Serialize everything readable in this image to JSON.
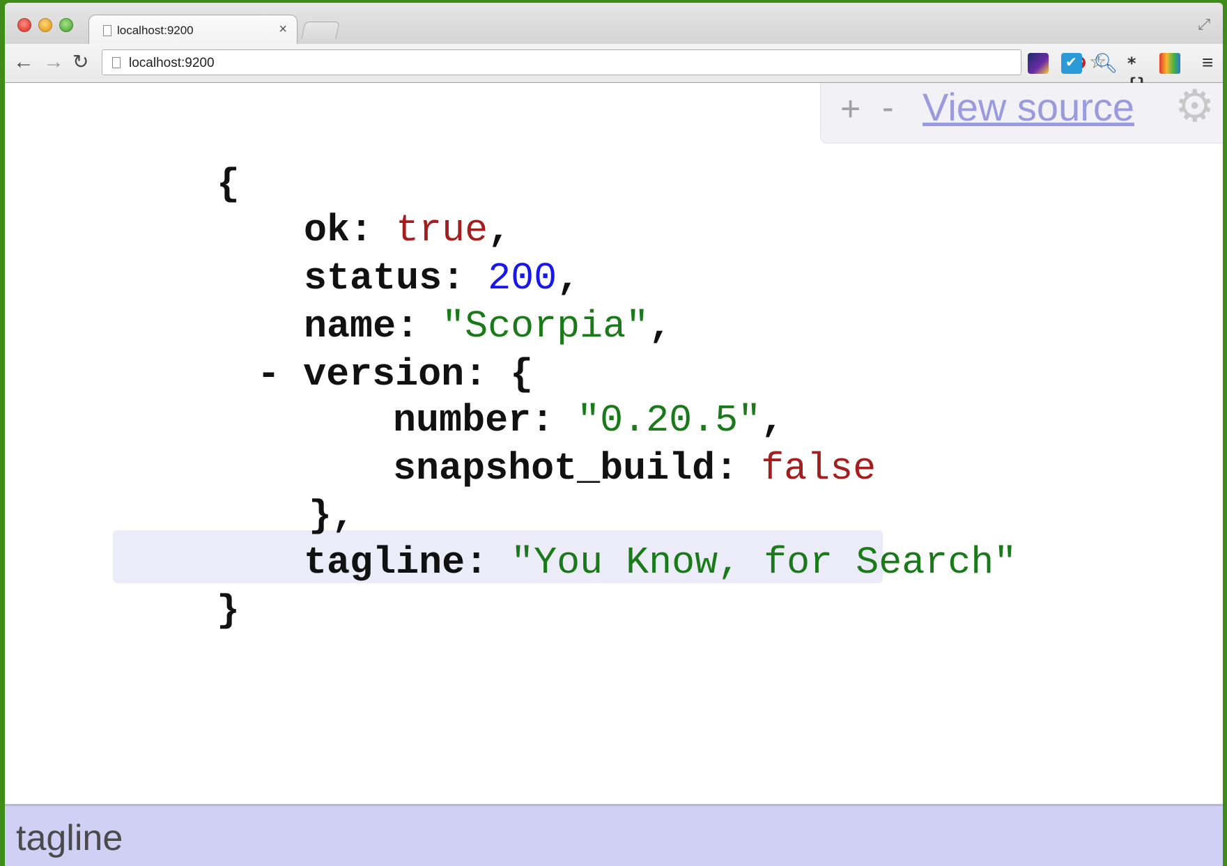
{
  "browser": {
    "tab": {
      "title": "localhost:9200",
      "close_glyph": "×"
    },
    "address_bar": {
      "url": "localhost:9200"
    },
    "nav": {
      "back": "←",
      "forward": "→",
      "reload": "↻"
    },
    "extensions": [
      "adblock-plus-icon",
      "bookmark-star-icon",
      "extension-icon",
      "checkmark-extension-icon",
      "search-extension-icon",
      "json-extension-icon",
      "color-extension-icon"
    ],
    "abp_label": "ABP",
    "json_ext_label": "*{}",
    "menu_glyph": "≡"
  },
  "viewer_toolbar": {
    "expand_label": "+",
    "collapse_label": "-",
    "view_source_label": "View source",
    "settings_glyph": "⚙"
  },
  "json": {
    "open_brace": "{",
    "ok": {
      "key": "ok:",
      "value": "true",
      "trail": ","
    },
    "status": {
      "key": "status:",
      "value": "200",
      "trail": ","
    },
    "name": {
      "key": "name:",
      "value": "\"Scorpia\"",
      "trail": ","
    },
    "version": {
      "toggle": "-",
      "key": "version:",
      "open": "{",
      "number": {
        "key": "number:",
        "value": "\"0.20.5\"",
        "trail": ","
      },
      "snapshot_build": {
        "key": "snapshot_build:",
        "value": "false"
      },
      "close": "},"
    },
    "tagline": {
      "key": "tagline:",
      "value": "\"You Know, for Search\""
    },
    "close_brace": "}"
  },
  "status_bar": {
    "path": "tagline"
  },
  "colors": {
    "boolean": "#a61d1d",
    "number": "#1717ef",
    "string": "#1a7a1a",
    "link": "#9a9ade",
    "status_bg": "#d0d0f4",
    "window_bg": "#3f8c1b"
  }
}
